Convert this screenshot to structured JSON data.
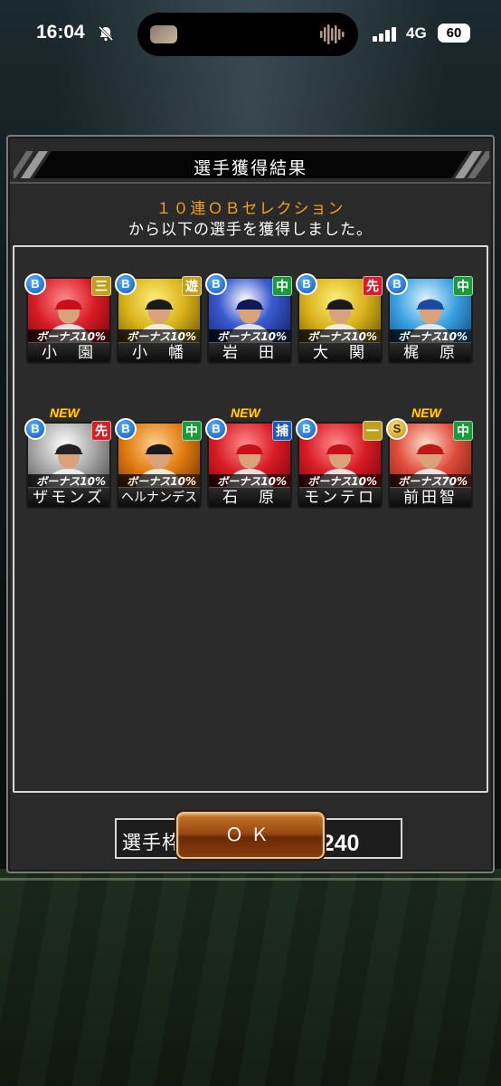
{
  "status_bar": {
    "time": "16:04",
    "network": "4G",
    "battery": "60"
  },
  "dialog": {
    "title": "選手獲得結果",
    "message_line1": "１０連ＯＢセレクション",
    "message_line2": "から以下の選手を獲得しました。",
    "slot_label": "選手枠：",
    "slot_value": "226／240",
    "ok_label": "ＯＫ"
  },
  "players": [
    {
      "name": "小　園",
      "rank": "B",
      "position": "三",
      "bonus": "ボーナス10%",
      "is_new": false,
      "new_label": "",
      "pos_color": "#c0a020",
      "photo": "red"
    },
    {
      "name": "小　幡",
      "rank": "B",
      "position": "遊",
      "bonus": "ボーナス10%",
      "is_new": false,
      "new_label": "",
      "pos_color": "#c0a020",
      "photo": "yellow"
    },
    {
      "name": "岩　田",
      "rank": "B",
      "position": "中",
      "bonus": "ボーナス10%",
      "is_new": false,
      "new_label": "",
      "pos_color": "#1a9a3a",
      "photo": "blue"
    },
    {
      "name": "大　関",
      "rank": "B",
      "position": "先",
      "bonus": "ボーナス10%",
      "is_new": false,
      "new_label": "",
      "pos_color": "#d0202a",
      "photo": "yellow"
    },
    {
      "name": "梶　原",
      "rank": "B",
      "position": "中",
      "bonus": "ボーナス10%",
      "is_new": false,
      "new_label": "",
      "pos_color": "#1a9a3a",
      "photo": "lightblue"
    },
    {
      "name": "ザモンズ",
      "rank": "B",
      "position": "先",
      "bonus": "ボーナス10%",
      "is_new": true,
      "new_label": "NEW",
      "pos_color": "#d0202a",
      "photo": "gray"
    },
    {
      "name": "ヘルナンデス",
      "rank": "B",
      "position": "中",
      "bonus": "ボーナス10%",
      "is_new": false,
      "new_label": "",
      "pos_color": "#1a9a3a",
      "photo": "orange"
    },
    {
      "name": "石　原",
      "rank": "B",
      "position": "捕",
      "bonus": "ボーナス10%",
      "is_new": true,
      "new_label": "NEW",
      "pos_color": "#1a5ab0",
      "photo": "red"
    },
    {
      "name": "モンテロ",
      "rank": "B",
      "position": "一",
      "bonus": "ボーナス10%",
      "is_new": false,
      "new_label": "",
      "pos_color": "#c0a020",
      "photo": "red"
    },
    {
      "name": "前田智",
      "rank": "S",
      "position": "中",
      "bonus": "ボーナス70%",
      "is_new": true,
      "new_label": "NEW",
      "pos_color": "#1a9a3a",
      "photo": "paleRed"
    }
  ]
}
